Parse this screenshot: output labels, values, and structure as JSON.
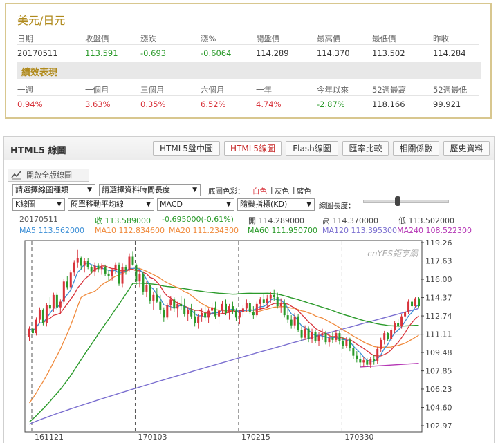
{
  "quote": {
    "title": "美元/日元",
    "headers": [
      "日期",
      "收盤價",
      "漲跌",
      "漲%",
      "開盤價",
      "最高價",
      "最低價",
      "昨收"
    ],
    "values": [
      "20170511",
      "113.591",
      "-0.693",
      "-0.6064",
      "114.289",
      "114.370",
      "113.502",
      "114.284"
    ],
    "perf_title": "績效表現",
    "perf_headers": [
      "一週",
      "一個月",
      "三個月",
      "六個月",
      "一年",
      "今年以來",
      "52週最高",
      "52週最低"
    ],
    "perf_values": [
      "0.94%",
      "3.63%",
      "0.35%",
      "6.52%",
      "4.74%",
      "-2.87%",
      "118.166",
      "99.921"
    ]
  },
  "panel": {
    "title": "HTML5 線圖",
    "tabs": [
      "HTML5盤中圖",
      "HTML5線圖",
      "Flash線圖",
      "匯率比較",
      "相關係數",
      "歷史資料"
    ],
    "active_tab": "HTML5線圖"
  },
  "toolbar": {
    "full_version": "開啟全版線圖",
    "chart_type": "請選擇線圖種類",
    "period": "請選擇資料時間長度",
    "bg_label": "底圖色彩：",
    "bg_white": "白色",
    "bg_gray": "灰色",
    "bg_blue": "藍色",
    "sep": "|",
    "kline": "K線圖",
    "ma_type": "簡單移動平均線",
    "indicator": "MACD",
    "random_indicator": "隨機指標(KD)",
    "length_label": "線圖長度："
  },
  "info": {
    "date": "20170511",
    "close": "收 113.589000",
    "change": "-0.695000(-0.61%)",
    "open": "開 114.289000",
    "high": "高 114.370000",
    "low": "低 113.502000",
    "ma5": "MA5 113.562000",
    "ma10": "MA10 112.834600",
    "ma20": "MA20 111.234300",
    "ma60": "MA60 111.950700",
    "ma120": "MA120 113.395300",
    "ma240": "MA240 108.522300"
  },
  "colors": {
    "up": "#d8333b",
    "down": "#2a9a2a",
    "ma5": "#3d8fd6",
    "ma10": "#d8333b",
    "ma20": "#f08a3c",
    "ma60": "#2a9a2a",
    "ma120": "#7b6fd0",
    "ma240": "#b536b5"
  },
  "chart_data": {
    "type": "candlestick",
    "watermark": "cnYES鉅亨網",
    "y_ticks": [
      "119.26",
      "117.63",
      "116.00",
      "114.37",
      "112.74",
      "111.11",
      "109.48",
      "107.85",
      "106.23",
      "104.60",
      "102.97"
    ],
    "ylim": [
      102.97,
      119.26
    ],
    "x_ticks": [
      "161121",
      "170103",
      "170215",
      "170330"
    ],
    "x_tick_index": [
      0,
      30,
      60,
      90
    ],
    "reference_line": 111.11,
    "candles": [
      [
        110.9,
        111.8,
        110.5,
        111.6
      ],
      [
        111.6,
        112.2,
        110.9,
        111.2
      ],
      [
        111.2,
        112.6,
        111.0,
        112.4
      ],
      [
        112.4,
        113.5,
        112.1,
        113.3
      ],
      [
        113.3,
        113.4,
        111.9,
        112.1
      ],
      [
        112.1,
        113.9,
        111.8,
        113.7
      ],
      [
        113.7,
        114.4,
        113.0,
        113.4
      ],
      [
        113.4,
        114.8,
        113.1,
        114.6
      ],
      [
        114.6,
        114.8,
        113.3,
        113.5
      ],
      [
        113.5,
        114.2,
        112.9,
        114.0
      ],
      [
        114.0,
        116.0,
        113.8,
        115.8
      ],
      [
        115.8,
        116.3,
        115.1,
        115.3
      ],
      [
        115.3,
        116.8,
        115.0,
        116.6
      ],
      [
        116.6,
        117.7,
        116.3,
        117.5
      ],
      [
        117.5,
        118.6,
        117.0,
        117.9
      ],
      [
        117.9,
        118.0,
        116.9,
        117.2
      ],
      [
        117.2,
        117.9,
        116.6,
        117.6
      ],
      [
        117.6,
        117.9,
        116.9,
        117.1
      ],
      [
        117.1,
        117.3,
        116.5,
        116.7
      ],
      [
        116.7,
        117.5,
        116.3,
        117.2
      ],
      [
        117.2,
        117.4,
        116.6,
        116.9
      ],
      [
        116.9,
        117.4,
        116.4,
        117.1
      ],
      [
        117.1,
        117.3,
        116.3,
        116.5
      ],
      [
        116.5,
        116.8,
        115.8,
        116.3
      ],
      [
        116.3,
        117.0,
        115.9,
        116.8
      ],
      [
        116.8,
        117.5,
        116.5,
        117.3
      ],
      [
        117.3,
        117.5,
        115.4,
        115.6
      ],
      [
        115.6,
        117.4,
        115.3,
        117.1
      ],
      [
        117.1,
        117.3,
        116.4,
        116.8
      ],
      [
        116.8,
        118.3,
        116.7,
        118.0
      ],
      [
        118.0,
        118.5,
        117.2,
        117.3
      ],
      [
        117.3,
        117.4,
        115.5,
        115.8
      ],
      [
        115.8,
        116.8,
        115.3,
        116.5
      ],
      [
        116.5,
        116.7,
        114.6,
        114.9
      ],
      [
        114.9,
        115.8,
        114.4,
        115.5
      ],
      [
        115.5,
        115.6,
        113.8,
        114.1
      ],
      [
        114.1,
        114.9,
        113.3,
        114.6
      ],
      [
        114.6,
        115.2,
        113.9,
        114.0
      ],
      [
        114.0,
        114.6,
        112.9,
        113.3
      ],
      [
        113.3,
        113.5,
        112.2,
        112.6
      ],
      [
        112.6,
        113.9,
        112.4,
        113.7
      ],
      [
        113.7,
        114.5,
        113.2,
        114.2
      ],
      [
        114.2,
        114.4,
        113.1,
        113.4
      ],
      [
        113.4,
        114.0,
        112.6,
        113.8
      ],
      [
        113.8,
        114.5,
        113.3,
        113.6
      ],
      [
        113.6,
        114.3,
        112.7,
        112.9
      ],
      [
        112.9,
        113.5,
        112.3,
        113.3
      ],
      [
        113.3,
        113.8,
        112.5,
        112.7
      ],
      [
        112.7,
        113.2,
        111.8,
        112.1
      ],
      [
        112.1,
        112.9,
        111.6,
        112.7
      ],
      [
        112.7,
        113.4,
        112.2,
        113.0
      ],
      [
        113.0,
        113.6,
        112.3,
        112.6
      ],
      [
        112.6,
        113.4,
        112.1,
        113.2
      ],
      [
        113.2,
        113.9,
        112.8,
        113.5
      ],
      [
        113.5,
        114.0,
        112.5,
        112.7
      ],
      [
        112.7,
        113.5,
        112.0,
        113.2
      ],
      [
        113.2,
        114.1,
        112.9,
        113.8
      ],
      [
        113.8,
        114.2,
        112.8,
        113.0
      ],
      [
        113.0,
        113.8,
        112.4,
        113.6
      ],
      [
        113.6,
        114.0,
        112.9,
        113.2
      ],
      [
        113.2,
        113.4,
        112.3,
        112.6
      ],
      [
        112.6,
        113.3,
        112.0,
        113.1
      ],
      [
        113.1,
        113.7,
        112.7,
        113.4
      ],
      [
        113.4,
        114.2,
        113.1,
        113.9
      ],
      [
        113.9,
        114.1,
        112.9,
        113.1
      ],
      [
        113.1,
        113.6,
        112.5,
        112.8
      ],
      [
        112.8,
        114.0,
        112.6,
        113.8
      ],
      [
        113.8,
        114.4,
        113.3,
        114.2
      ],
      [
        114.2,
        114.7,
        113.6,
        113.9
      ],
      [
        113.9,
        114.6,
        113.5,
        114.3
      ],
      [
        114.3,
        114.9,
        113.9,
        114.6
      ],
      [
        114.6,
        115.1,
        114.1,
        114.4
      ],
      [
        114.4,
        114.8,
        113.4,
        113.6
      ],
      [
        113.6,
        114.3,
        113.0,
        113.9
      ],
      [
        113.9,
        114.2,
        112.6,
        112.8
      ],
      [
        112.8,
        113.4,
        112.1,
        112.4
      ],
      [
        112.4,
        112.8,
        111.6,
        111.9
      ],
      [
        111.9,
        113.0,
        111.6,
        112.7
      ],
      [
        112.7,
        112.9,
        111.3,
        111.5
      ],
      [
        111.5,
        111.8,
        110.5,
        110.8
      ],
      [
        110.8,
        111.9,
        110.6,
        111.6
      ],
      [
        111.6,
        111.8,
        110.4,
        110.7
      ],
      [
        110.7,
        111.6,
        110.3,
        111.3
      ],
      [
        111.3,
        111.5,
        110.3,
        110.5
      ],
      [
        110.5,
        111.3,
        110.1,
        111.0
      ],
      [
        111.0,
        111.6,
        110.6,
        111.2
      ],
      [
        111.2,
        111.4,
        110.2,
        110.4
      ],
      [
        110.4,
        111.1,
        110.0,
        110.8
      ],
      [
        110.8,
        111.3,
        110.3,
        110.6
      ],
      [
        110.6,
        111.5,
        110.4,
        111.2
      ],
      [
        111.2,
        111.4,
        110.2,
        110.5
      ],
      [
        110.5,
        110.9,
        109.8,
        110.1
      ],
      [
        110.1,
        110.9,
        109.9,
        110.6
      ],
      [
        110.6,
        110.8,
        109.6,
        109.9
      ],
      [
        109.9,
        110.2,
        108.9,
        109.2
      ],
      [
        109.2,
        109.6,
        108.6,
        108.9
      ],
      [
        108.9,
        109.3,
        108.2,
        108.6
      ],
      [
        108.6,
        109.1,
        108.2,
        108.8
      ],
      [
        108.8,
        109.0,
        108.2,
        108.4
      ],
      [
        108.4,
        109.1,
        108.1,
        108.9
      ],
      [
        108.9,
        109.3,
        108.4,
        108.7
      ],
      [
        108.7,
        110.0,
        108.5,
        109.8
      ],
      [
        109.8,
        110.8,
        109.5,
        110.6
      ],
      [
        110.6,
        111.4,
        110.2,
        111.2
      ],
      [
        111.2,
        111.3,
        110.5,
        110.7
      ],
      [
        110.7,
        111.7,
        110.5,
        111.5
      ],
      [
        111.5,
        112.3,
        111.2,
        112.1
      ],
      [
        112.1,
        112.5,
        111.5,
        111.8
      ],
      [
        111.8,
        112.9,
        111.6,
        112.7
      ],
      [
        112.7,
        113.3,
        112.4,
        113.1
      ],
      [
        113.1,
        114.2,
        112.9,
        114.0
      ],
      [
        114.0,
        114.3,
        113.3,
        113.6
      ],
      [
        113.6,
        114.4,
        113.5,
        114.3
      ],
      [
        114.3,
        114.4,
        113.5,
        113.6
      ]
    ]
  }
}
